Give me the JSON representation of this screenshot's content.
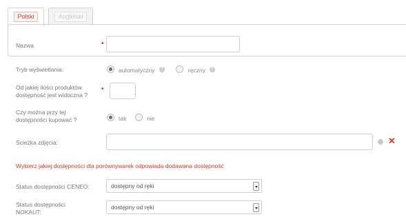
{
  "tabs": [
    {
      "label": "Polski",
      "active": true
    },
    {
      "label": "Angielski",
      "active": false
    }
  ],
  "form": {
    "name": {
      "label": "Nazwa",
      "value": ""
    },
    "display_mode": {
      "label": "Tryb wyświetlania:",
      "options": [
        {
          "label": "automatyczny",
          "checked": true
        },
        {
          "label": "ręczny",
          "checked": false
        }
      ]
    },
    "min_qty": {
      "label_line1": "Od jakiej ilości produktów",
      "label_line2": "dostępność jest widoczna ?",
      "value": ""
    },
    "can_buy": {
      "label_line1": "Czy można przy tej",
      "label_line2": "dostępności kupować ?",
      "options": [
        {
          "label": "tak",
          "checked": true
        },
        {
          "label": "nie",
          "checked": false
        }
      ]
    },
    "image_path": {
      "label": "Ścieżka zdjęcia:",
      "value": ""
    },
    "warning": "Wybierz jakiej dostępności dla porównywarek odpowiada dodawana dostępność",
    "ceneo": {
      "label": "Status dostępności CENEO:",
      "value": "dostępny od ręki"
    },
    "nokaut": {
      "label_line1": "Status dostępności",
      "label_line2": "NOKAUT:",
      "value": "dostępny od ręki"
    }
  },
  "colors": {
    "accent": "#d43a2a",
    "border": "#cfcfcf"
  }
}
